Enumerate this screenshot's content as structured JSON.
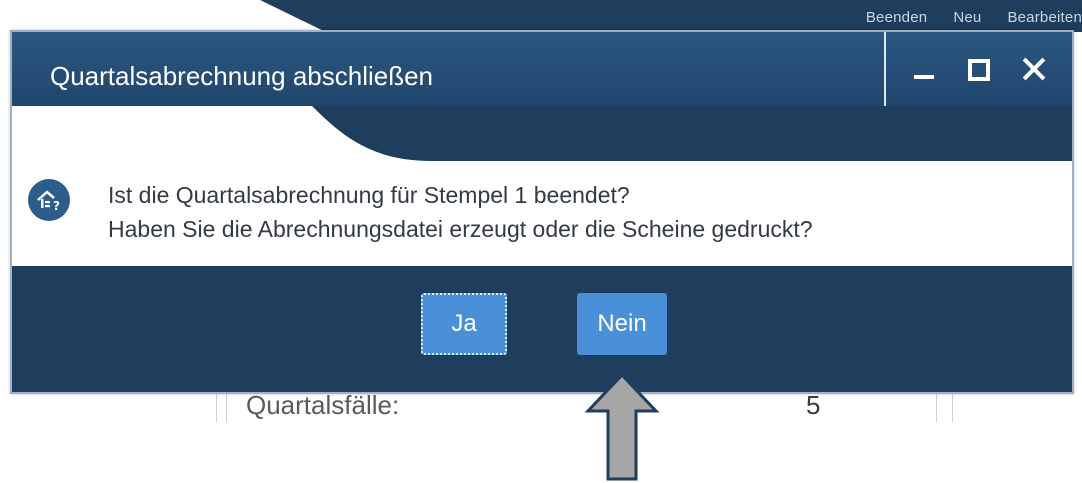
{
  "background": {
    "menu": [
      "Beenden",
      "Neu",
      "Bearbeiten"
    ],
    "row_label": "Quartalsfälle:",
    "row_value": "5"
  },
  "dialog": {
    "title": "Quartalsabrechnung abschließen",
    "message_line1": "Ist die Quartalsabrechnung für Stempel 1 beendet?",
    "message_line2": "Haben Sie die Abrechnungsdatei erzeugt oder die Scheine gedruckt?",
    "yes_label": "Ja",
    "no_label": "Nein",
    "icon": "question-icon"
  },
  "colors": {
    "dialog_navy": "#1f3d5c",
    "title_blue": "#2c5780",
    "button_blue": "#4a90d9",
    "arrow_gray": "#a6a6a6",
    "arrow_outline": "#1f3d5c"
  }
}
